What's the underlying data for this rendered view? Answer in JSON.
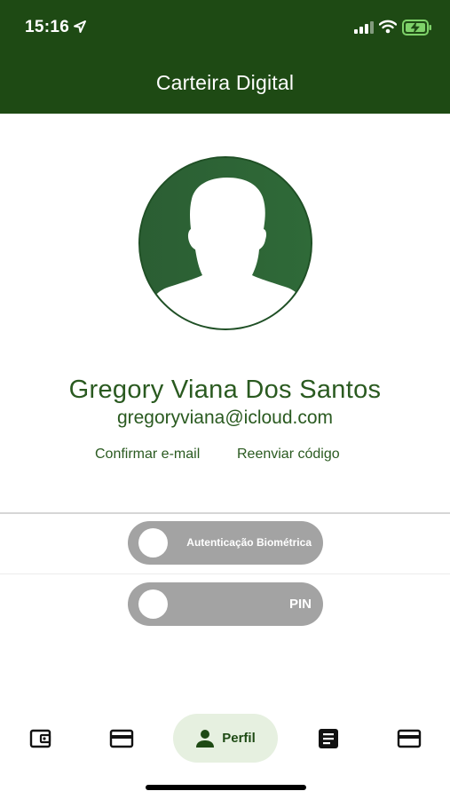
{
  "status_bar": {
    "time": "15:16",
    "icons": [
      "location-arrow-icon",
      "signal-icon",
      "wifi-icon",
      "battery-charging-icon"
    ]
  },
  "header": {
    "title": "Carteira Digital",
    "background_color": "#1e4a14"
  },
  "profile": {
    "avatar_icon": "person-silhouette-icon",
    "name": "Gregory Viana Dos Santos",
    "email": "gregoryviana@icloud.com",
    "confirm_email_link": "Confirmar e-mail",
    "resend_code_link": "Reenviar código",
    "accent_color": "#2a5a20"
  },
  "settings": {
    "biometric_toggle": {
      "label": "Autenticação Biométrica",
      "enabled": false
    },
    "pin_toggle": {
      "label": "PIN",
      "enabled": false
    }
  },
  "tab_bar": {
    "items": [
      {
        "icon": "wallet-icon",
        "label": "",
        "active": false
      },
      {
        "icon": "credit-card-icon",
        "label": "",
        "active": false
      },
      {
        "icon": "person-icon",
        "label": "Perfil",
        "active": true
      },
      {
        "icon": "document-icon",
        "label": "",
        "active": false
      },
      {
        "icon": "credit-card-icon",
        "label": "",
        "active": false
      }
    ],
    "active_background": "#e6f0e0"
  }
}
